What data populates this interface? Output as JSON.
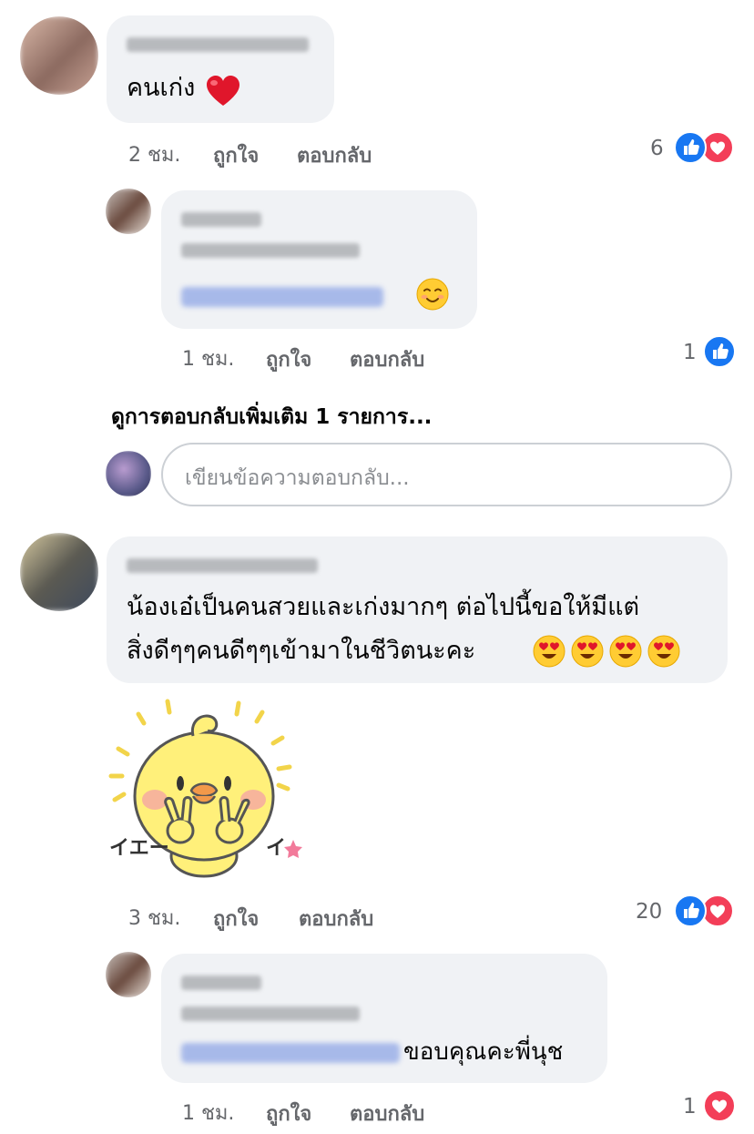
{
  "comments": [
    {
      "text": "คนเก่ง",
      "emoji": "heart",
      "time": "2 ชม.",
      "like": "ถูกใจ",
      "reply": "ตอบกลับ",
      "count": "6",
      "reactions": [
        "like-icon",
        "love-icon"
      ]
    },
    {
      "text": "น้องเอ๋เป็นคนสวยและเก่งมากๆ ต่อไปนี้ขอให้มีแต่",
      "text2": "สิ่งดีๆๆคนดีๆๆเข้ามาในชีวิตนะคะ",
      "emoji": "heart-eyes",
      "time": "3 ชม.",
      "like": "ถูกใจ",
      "reply": "ตอบกลับ",
      "count": "20",
      "reactions": [
        "like-icon",
        "love-icon"
      ]
    }
  ],
  "replies": [
    {
      "emoji": "smiling-face",
      "time": "1 ชม.",
      "like": "ถูกใจ",
      "reply": "ตอบกลับ",
      "count": "1",
      "reactions": [
        "like-icon"
      ]
    },
    {
      "text": "ขอบคุณคะพี่นุช",
      "time": "1 ชม.",
      "like": "ถูกใจ",
      "reply": "ตอบกลับ",
      "count": "1",
      "reactions": [
        "love-icon"
      ]
    }
  ],
  "more_replies": "ดูการตอบกลับเพิ่มเติม 1 รายการ...",
  "reply_box": {
    "placeholder": "เขียนข้อความตอบกลับ..."
  },
  "sticker": {
    "text_left": "イエー",
    "text_right": "イ"
  },
  "colors": {
    "like": "#1877f2",
    "love": "#f33e58",
    "bubble": "#f0f2f5",
    "meta": "#65676b"
  }
}
